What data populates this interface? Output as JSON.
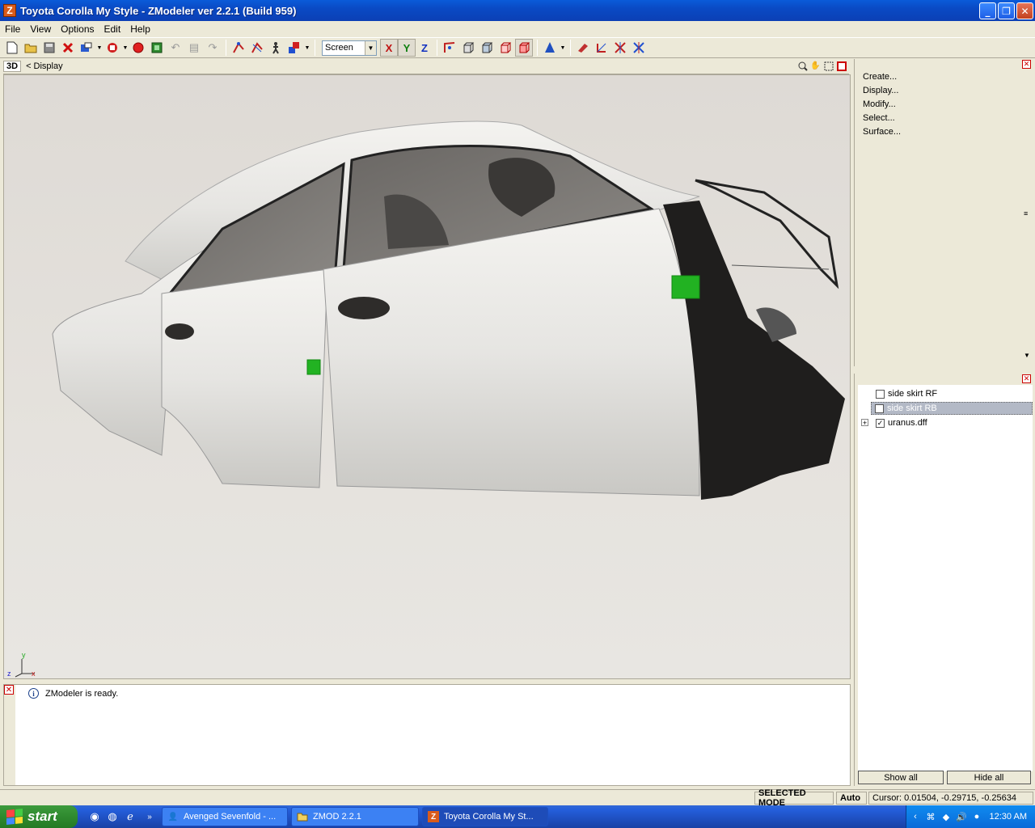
{
  "window": {
    "app_icon": "Z",
    "title": "Toyota Corolla My Style - ZModeler ver 2.2.1 (Build 959)",
    "buttons": {
      "minimize": "_",
      "maximize": "❐",
      "close": "✕"
    }
  },
  "menu": [
    {
      "id": "file",
      "label": "File"
    },
    {
      "id": "view",
      "label": "View"
    },
    {
      "id": "options",
      "label": "Options"
    },
    {
      "id": "edit",
      "label": "Edit"
    },
    {
      "id": "help",
      "label": "Help"
    }
  ],
  "toolbar": {
    "file_icons": [
      "new-file-icon",
      "open-folder-icon",
      "save-icon",
      "delete-icon",
      "import-icon",
      "export-icon",
      "record-icon",
      "render-icon",
      "undo-icon",
      "clipboard-icon",
      "redo-icon"
    ],
    "select_icons": [
      "select-vertex-icon",
      "select-edge-icon",
      "walk-icon",
      "group-select-icon"
    ],
    "space_select": {
      "value": "Screen"
    },
    "axes": {
      "x": "X",
      "y": "Y",
      "z": "Z"
    },
    "view_icons": [
      "vertex-mode-icon",
      "face-mode-icon",
      "object-mode-icon",
      "box-mode-icon",
      "solid-mode-icon"
    ],
    "tool_icons": [
      "cone-icon",
      "paint-icon",
      "axis-move-icon",
      "axis-scale-icon",
      "axis-rotate-icon"
    ]
  },
  "viewport": {
    "mode": "3D",
    "label": "< Display",
    "tools": [
      "zoom-icon",
      "pan-icon",
      "fit-icon",
      "close-icon"
    ],
    "axis": {
      "y": "y",
      "x": "x",
      "z": "z"
    }
  },
  "command_panel": {
    "items": [
      "Create...",
      "Display...",
      "Modify...",
      "Select...",
      "Surface..."
    ]
  },
  "object_tree": {
    "items": [
      {
        "label": "side skirt RF",
        "checked": false,
        "selected": false,
        "expandable": false
      },
      {
        "label": "side skirt RB",
        "checked": false,
        "selected": true,
        "expandable": false
      },
      {
        "label": "uranus.dff",
        "checked": true,
        "selected": false,
        "expandable": true
      }
    ],
    "show_all": "Show all",
    "hide_all": "Hide all"
  },
  "log": {
    "message": "ZModeler is ready.",
    "info_icon": "i"
  },
  "status": {
    "mode": "SELECTED MODE",
    "snap": "Auto",
    "cursor": "Cursor: 0.01504, -0.29715, -0.25634"
  },
  "taskbar": {
    "start": "start",
    "tasks": [
      {
        "label": "Avenged Sevenfold - ...",
        "icon": "user-icon",
        "active": false
      },
      {
        "label": "ZMOD 2.2.1",
        "icon": "folder-icon",
        "active": false
      },
      {
        "label": "Toyota Corolla My St...",
        "icon": "zmodeler-icon",
        "active": true
      }
    ],
    "clock": "12:30 AM"
  }
}
